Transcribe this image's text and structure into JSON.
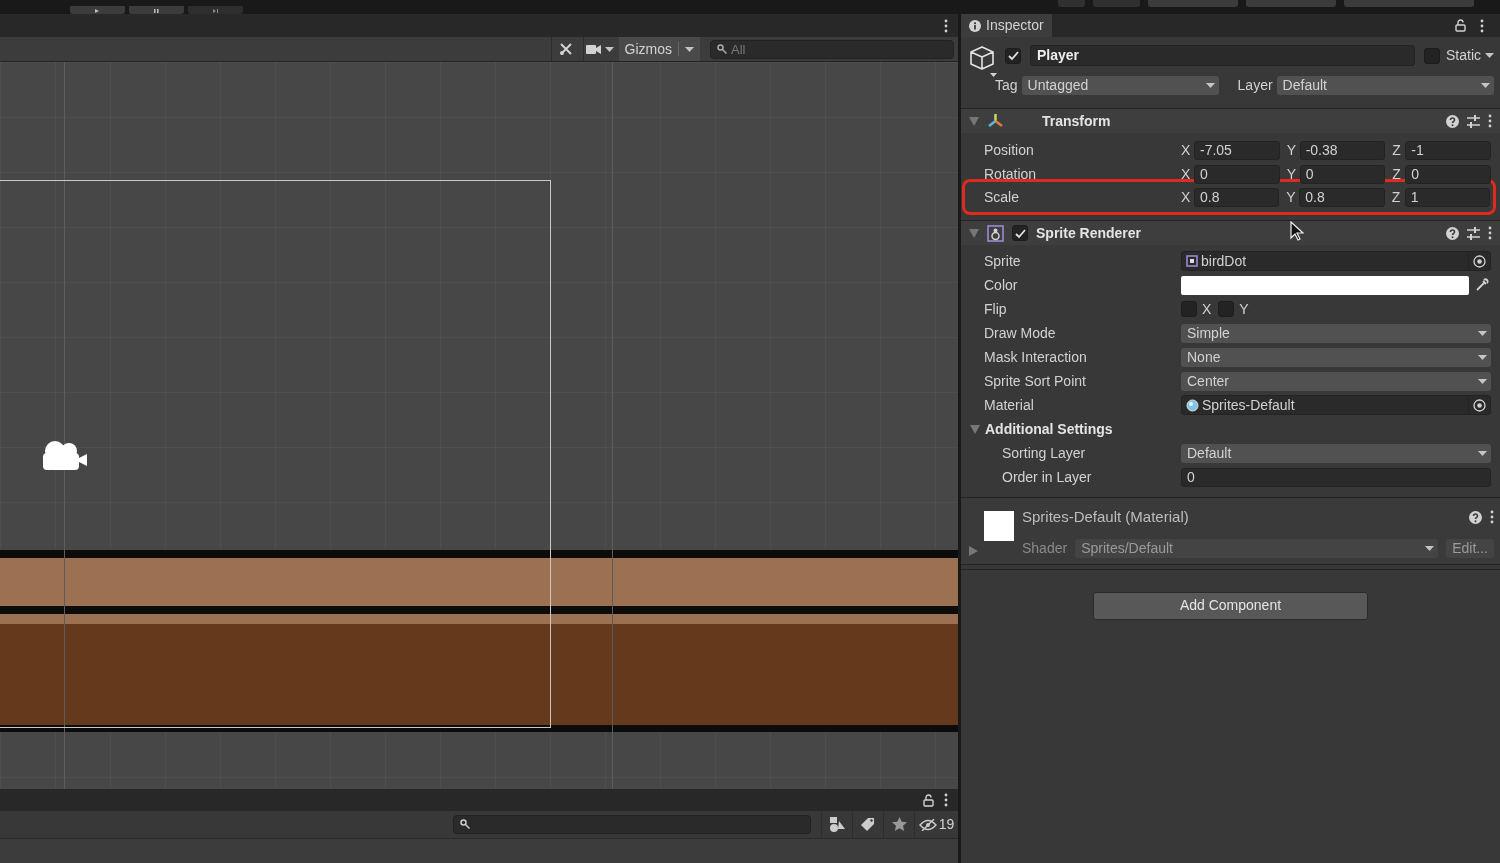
{
  "scene_view": {
    "gizmos_label": "Gizmos",
    "search_placeholder": "All"
  },
  "hierarchy": {
    "hidden_count": "19"
  },
  "inspector": {
    "tab": "Inspector",
    "object": {
      "active": true,
      "name": "Player",
      "static": false,
      "static_label": "Static",
      "tag_label": "Tag",
      "tag": "Untagged",
      "layer_label": "Layer",
      "layer": "Default"
    },
    "components": [
      {
        "kind": "transform",
        "title": "Transform",
        "expanded": true,
        "rows": [
          {
            "label": "Position",
            "highlighted": false,
            "values": [
              {
                "axis": "X",
                "value": "-7.05"
              },
              {
                "axis": "Y",
                "value": "-0.38"
              },
              {
                "axis": "Z",
                "value": "-1"
              }
            ]
          },
          {
            "label": "Rotation",
            "highlighted": false,
            "values": [
              {
                "axis": "X",
                "value": "0"
              },
              {
                "axis": "Y",
                "value": "0"
              },
              {
                "axis": "Z",
                "value": "0"
              }
            ]
          },
          {
            "label": "Scale",
            "highlighted": true,
            "values": [
              {
                "axis": "X",
                "value": "0.8"
              },
              {
                "axis": "Y",
                "value": "0.8"
              },
              {
                "axis": "Z",
                "value": "1"
              }
            ]
          }
        ]
      },
      {
        "kind": "sprite_renderer",
        "title": "Sprite Renderer",
        "enabled": true,
        "expanded": true,
        "fields": [
          {
            "kind": "sprite_ref",
            "label": "Sprite",
            "value": "birdDot"
          },
          {
            "kind": "color",
            "label": "Color",
            "color": "#ffffff"
          },
          {
            "kind": "flip",
            "label": "Flip",
            "options": [
              {
                "label": "X",
                "checked": false
              },
              {
                "label": "Y",
                "checked": false
              }
            ]
          },
          {
            "kind": "dropdown",
            "label": "Draw Mode",
            "value": "Simple"
          },
          {
            "kind": "dropdown",
            "label": "Mask Interaction",
            "value": "None"
          },
          {
            "kind": "dropdown",
            "label": "Sprite Sort Point",
            "value": "Center"
          },
          {
            "kind": "material_ref",
            "label": "Material",
            "value": "Sprites-Default"
          },
          {
            "kind": "group",
            "label": "Additional Settings",
            "expanded": true,
            "children": [
              {
                "kind": "dropdown",
                "label": "Sorting Layer",
                "value": "Default"
              },
              {
                "kind": "number",
                "label": "Order in Layer",
                "value": "0"
              }
            ]
          }
        ]
      }
    ],
    "material": {
      "name": "Sprites-Default (Material)",
      "expanded": false,
      "shader_label": "Shader",
      "shader": "Sprites/Default",
      "edit_button": "Edit..."
    },
    "add_component": "Add Component"
  }
}
